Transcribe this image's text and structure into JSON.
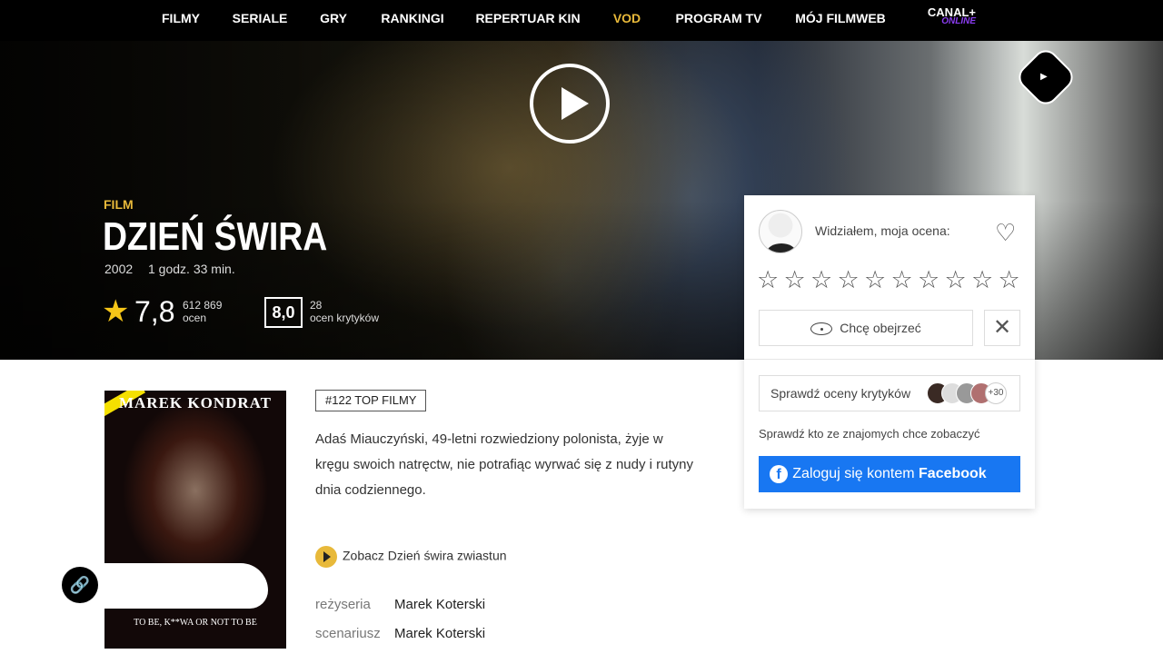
{
  "nav": {
    "items": [
      "FILMY",
      "SERIALE",
      "GRY",
      "RANKINGI",
      "REPERTUAR KIN",
      "VOD",
      "PROGRAM TV",
      "MÓJ FILMWEB"
    ],
    "canal": "CANAL+",
    "canal_sub": "ONLINE"
  },
  "hero": {
    "label": "FILM",
    "title": "DZIEŃ ŚWIRA",
    "year": "2002",
    "duration": "1 godz. 33 min.",
    "rating": "7,8",
    "votes": "612 869",
    "votes_label": "ocen",
    "critics_rating": "8,0",
    "critics_count": "28",
    "critics_label": "ocen krytyków"
  },
  "card": {
    "seen": "Widziałem, moja ocena:",
    "want": "Chcę obejrzeć",
    "critics": "Sprawdź oceny krytyków",
    "critics_more": "+30",
    "friends": "Sprawdź kto ze znajomych chce zobaczyć",
    "fb_pre": "Zaloguj się kontem ",
    "fb_bold": "Facebook"
  },
  "poster": {
    "actor": "MAREK KONDRAT",
    "tagline": "TO BE, K**WA OR NOT TO BE"
  },
  "main": {
    "badge": "#122 TOP FILMY",
    "description": "Adaś Miauczyński, 49-letni rozwiedziony polonista, żyje w kręgu swoich natręctw, nie potrafiąc wyrwać się z nudy i rutyny dnia codziennego.",
    "trailer": "Zobacz Dzień świra zwiastun",
    "credits": [
      {
        "label": "reżyseria",
        "value": "Marek Koterski"
      },
      {
        "label": "scenariusz",
        "value": "Marek Koterski"
      }
    ]
  },
  "colors": {
    "accent": "#e8b93a",
    "facebook": "#1877f2"
  }
}
